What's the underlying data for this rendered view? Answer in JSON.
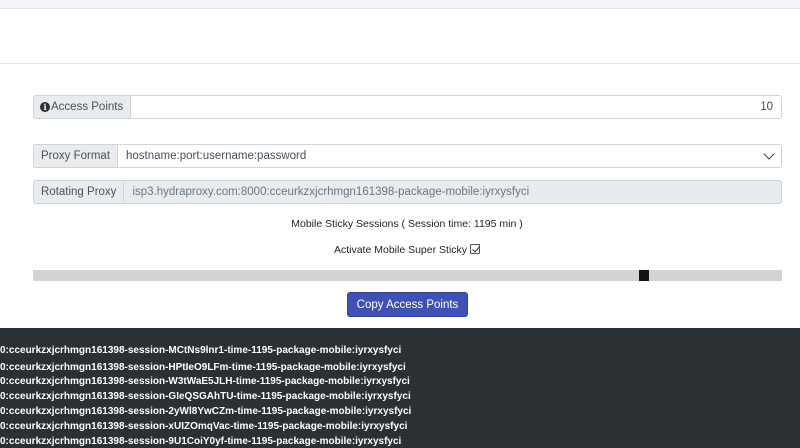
{
  "access_points": {
    "label": "Access Points",
    "value": "10"
  },
  "proxy_format": {
    "label": "Proxy Format",
    "selected": "hostname:port:username:password"
  },
  "rotating_proxy": {
    "label": "Rotating Proxy",
    "value": "isp3.hydraproxy.com:8000:cceurkzxjcrhmgn161398-package-mobile:iyrxysfyci"
  },
  "sticky_sessions": {
    "text": "Mobile Sticky Sessions ( Session time: 1195 min )"
  },
  "super_sticky": {
    "label": "Activate Mobile Super Sticky",
    "checked": true
  },
  "session_slider": {
    "fraction": 0.82
  },
  "copy_button": {
    "label": "Copy Access Points"
  },
  "output_lines": [
    "0:cceurkzxjcrhmgn161398-session-MCtNs9lnr1-time-1195-package-mobile:iyrxysfyci",
    "0:cceurkzxjcrhmgn161398-session-HPtIeO9LFm-time-1195-package-mobile:iyrxysfyci",
    "0:cceurkzxjcrhmgn161398-session-W3tWaE5JLH-time-1195-package-mobile:iyrxysfyci",
    "0:cceurkzxjcrhmgn161398-session-GIeQSGAhTU-time-1195-package-mobile:iyrxysfyci",
    "0:cceurkzxjcrhmgn161398-session-2yWl8YwCZm-time-1195-package-mobile:iyrxysfyci",
    "0:cceurkzxjcrhmgn161398-session-xUIZOmqVac-time-1195-package-mobile:iyrxysfyci",
    "0:cceurkzxjcrhmgn161398-session-9U1CoiY0yf-time-1195-package-mobile:iyrxysfyci"
  ]
}
